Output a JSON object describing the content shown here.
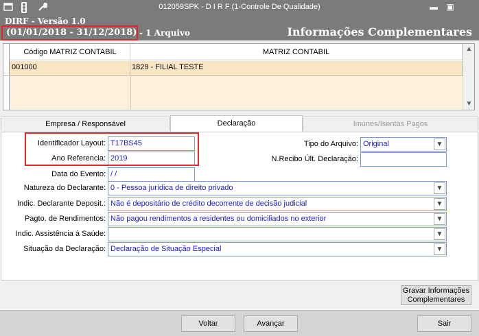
{
  "titlebar": {
    "title": "012059SPK - D I R F (1-Controle De Qualidade)",
    "icons": [
      "window-menu-icon",
      "traffic-light-icon",
      "wrench-icon"
    ],
    "minimize": "▬",
    "maximize": "▣"
  },
  "header": {
    "app_version": "DIRF - Versão 1.0",
    "period": "(01/01/2018 - 31/12/2018)",
    "file_count": "- 1 Arquivo",
    "title": "Informações Complementares"
  },
  "grid": {
    "columns": [
      "Código MATRIZ CONTABIL",
      "MATRIZ CONTABIL"
    ],
    "rows": [
      {
        "code": "001000",
        "name": "1829 - FILIAL TESTE"
      }
    ]
  },
  "tabs": [
    {
      "label": "Empresa / Responsável",
      "state": "inactive"
    },
    {
      "label": "Declaração",
      "state": "active"
    },
    {
      "label": "Imunes/Isentas Pagos",
      "state": "disabled"
    }
  ],
  "form": {
    "identificador_layout": {
      "label": "Identificador Layout:",
      "value": "T17BS45"
    },
    "ano_referencia": {
      "label": "Ano Referencia:",
      "value": "2019"
    },
    "data_evento": {
      "label": "Data do Evento:",
      "value": " / /"
    },
    "tipo_arquivo": {
      "label": "Tipo do Arquivo:",
      "value": "Original"
    },
    "nrecibo": {
      "label": "N.Recibo Últ. Declaração:",
      "value": ""
    },
    "natureza": {
      "label": "Natureza do Declarante:",
      "value": "0 - Pessoa jurídica de direito privado"
    },
    "indic_deposit": {
      "label": "Indic. Declarante Deposit.:",
      "value": "Não é depositário de crédito decorrente de decisão judicial"
    },
    "pagto_rend": {
      "label": "Pagto. de Rendimentos:",
      "value": "Não pagou rendimentos a residentes ou domiciliados no exterior"
    },
    "indic_saude": {
      "label": "Indic. Assistência à Saúde:",
      "value": ""
    },
    "situacao": {
      "label": "Situação da Declaração:",
      "value": "Declaração de Situação Especial"
    }
  },
  "buttons": {
    "gravar_line1": "Gravar Informações",
    "gravar_line2": "Complementares",
    "voltar": "Voltar",
    "avancar": "Avançar",
    "sair": "Sair"
  },
  "colors": {
    "header_bg": "#7b7b7b",
    "row_highlight": "#fbe6c4",
    "value_text": "#1a1ad0",
    "annotation_red": "#e8222e"
  }
}
